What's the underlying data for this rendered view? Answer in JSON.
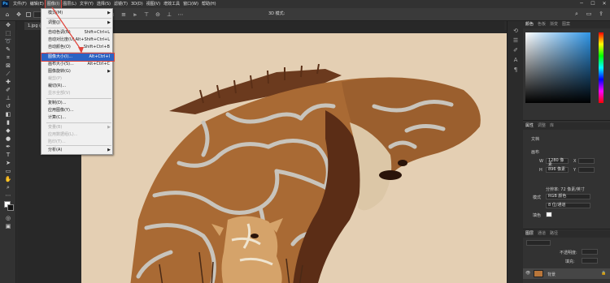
{
  "menubar": {
    "logo": "Ps",
    "items": [
      "文件(F)",
      "编辑(E)",
      "图像(I)",
      "图层(L)",
      "文字(Y)",
      "选择(S)",
      "滤镜(T)",
      "3D(D)",
      "视图(V)",
      "增效工具",
      "窗口(W)",
      "帮助(H)"
    ],
    "active_index": 2,
    "window_buttons": [
      "─",
      "☐",
      "✕"
    ]
  },
  "options_bar": {
    "mode_label": "3D 模式:"
  },
  "document_tab": {
    "label": "1.jpg @"
  },
  "image_menu": {
    "items": [
      {
        "label": "模式(M)",
        "shortcut": "",
        "submenu": true,
        "disabled": false
      },
      {
        "label": "调整(J)",
        "shortcut": "",
        "submenu": true,
        "disabled": false
      },
      {
        "label": "自动色调(N)",
        "shortcut": "Shift+Ctrl+L",
        "submenu": false,
        "disabled": false
      },
      {
        "label": "自动对比度(U)",
        "shortcut": "Alt+Shift+Ctrl+L",
        "submenu": false,
        "disabled": false
      },
      {
        "label": "自动颜色(O)",
        "shortcut": "Shift+Ctrl+B",
        "submenu": false,
        "disabled": false
      },
      {
        "label": "图像大小(I)...",
        "shortcut": "Alt+Ctrl+I",
        "submenu": false,
        "disabled": false,
        "highlighted": true
      },
      {
        "label": "画布大小(S)...",
        "shortcut": "Alt+Ctrl+C",
        "submenu": false,
        "disabled": false
      },
      {
        "label": "图像旋转(G)",
        "shortcut": "",
        "submenu": true,
        "disabled": false
      },
      {
        "label": "裁剪(P)",
        "shortcut": "",
        "submenu": false,
        "disabled": true
      },
      {
        "label": "裁切(R)...",
        "shortcut": "",
        "submenu": false,
        "disabled": false
      },
      {
        "label": "显示全部(V)",
        "shortcut": "",
        "submenu": false,
        "disabled": true
      },
      {
        "label": "复制(D)...",
        "shortcut": "",
        "submenu": false,
        "disabled": false
      },
      {
        "label": "应用图像(Y)...",
        "shortcut": "",
        "submenu": false,
        "disabled": false
      },
      {
        "label": "计算(C)...",
        "shortcut": "",
        "submenu": false,
        "disabled": false
      },
      {
        "label": "变量(B)",
        "shortcut": "",
        "submenu": true,
        "disabled": true
      },
      {
        "label": "应用数据组(L)...",
        "shortcut": "",
        "submenu": false,
        "disabled": true
      },
      {
        "label": "陷印(T)...",
        "shortcut": "",
        "submenu": false,
        "disabled": true
      },
      {
        "label": "分析(A)",
        "shortcut": "",
        "submenu": true,
        "disabled": false
      }
    ]
  },
  "color_panel": {
    "tabs": [
      "颜色",
      "色板",
      "渐变",
      "图案"
    ]
  },
  "properties_panel": {
    "tabs": [
      "属性",
      "调整",
      "库"
    ],
    "doc_label": "文档",
    "canvas_label": "画布",
    "width_label": "W",
    "width_value": "1280 像素",
    "x_label": "X",
    "height_label": "H",
    "height_value": "896 像素",
    "y_label": "Y",
    "resolution": "分辨率: 72 像素/英寸",
    "mode_label": "模式",
    "mode_value": "RGB 颜色",
    "depth_value": "8 位/通道",
    "fill_label": "填色"
  },
  "layers_panel": {
    "tabs": [
      "图层",
      "通道",
      "路径"
    ],
    "layer_name": "背景",
    "opacity_label": "不透明度:",
    "fill_label": "填充:"
  },
  "colors": {
    "ui_dark": "#323232",
    "menu_highlight": "#2b63c4",
    "annotation_red": "#e0443b",
    "canvas_bg": "#e4cfb3",
    "giraffe_brown": "#b9763a",
    "foreground_color": "#ffffff",
    "background_color": "#111111"
  }
}
